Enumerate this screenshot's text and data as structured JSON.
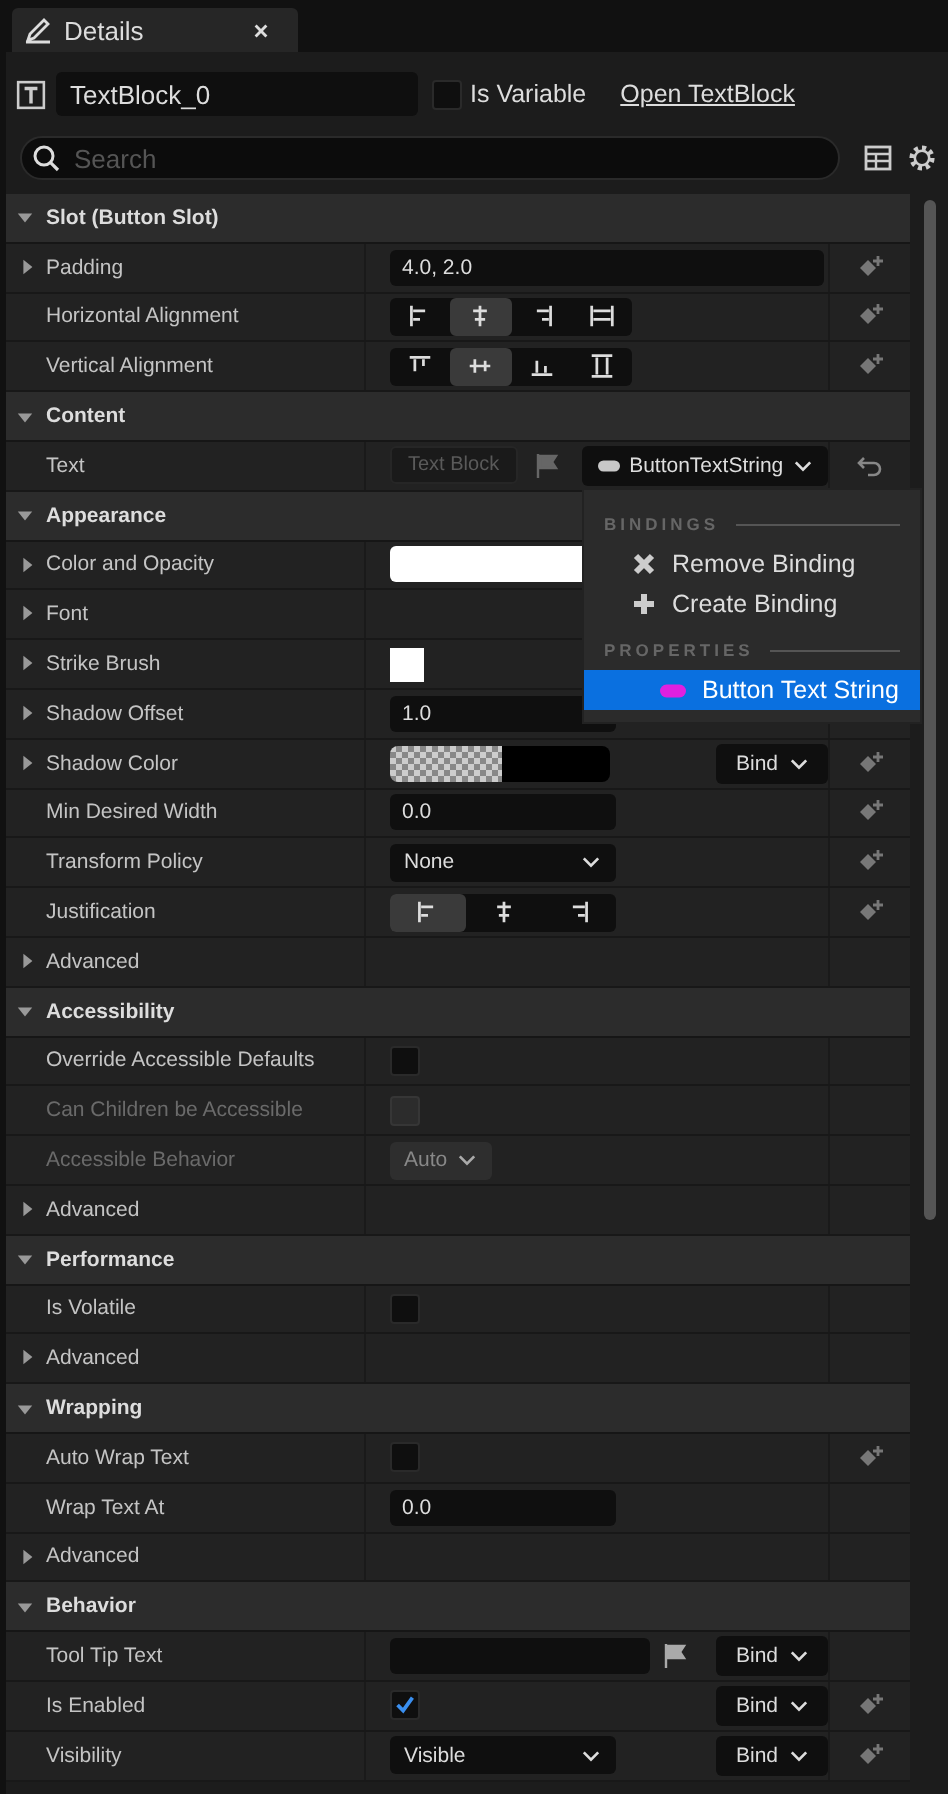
{
  "tab": {
    "title": "Details"
  },
  "header": {
    "name": "TextBlock_0",
    "is_variable": {
      "label": "Is Variable",
      "checked": false
    },
    "link": "Open TextBlock"
  },
  "search": {
    "placeholder": "Search"
  },
  "sections": [
    {
      "title": "Slot (Button Slot)",
      "expanded": true,
      "rows": [
        {
          "label": "Padding",
          "kind": "vector",
          "expanded": false,
          "value": "4.0, 2.0",
          "keyframe": true
        },
        {
          "label": "Horizontal Alignment",
          "kind": "halign",
          "options": [
            {
              "selected": false
            },
            {
              "selected": true
            },
            {
              "selected": false
            },
            {
              "selected": false
            }
          ],
          "keyframe": true
        },
        {
          "label": "Vertical Alignment",
          "kind": "valign",
          "options": [
            {
              "selected": false
            },
            {
              "selected": true
            },
            {
              "selected": false
            },
            {
              "selected": false
            }
          ],
          "keyframe": true
        }
      ]
    },
    {
      "title": "Content",
      "expanded": true,
      "rows": [
        {
          "label": "Text",
          "kind": "binding",
          "value": "Text Block",
          "binding": "ButtonTextString"
        }
      ]
    },
    {
      "title": "Appearance",
      "expanded": true,
      "rows": [
        {
          "label": "Color and Opacity",
          "kind": "color",
          "expanded": false
        },
        {
          "label": "Font",
          "kind": "none",
          "expanded": false
        },
        {
          "label": "Strike Brush",
          "kind": "brush",
          "expanded": false
        },
        {
          "label": "Shadow Offset",
          "kind": "number",
          "expanded": false,
          "value": "1.0"
        },
        {
          "label": "Shadow Color",
          "kind": "shadow",
          "expanded": false,
          "bind": "Bind",
          "keyframe": true
        },
        {
          "label": "Min Desired Width",
          "kind": "number",
          "value": "0.0",
          "keyframe": true
        },
        {
          "label": "Transform Policy",
          "kind": "dropdown",
          "value": "None",
          "keyframe": true
        },
        {
          "label": "Justification",
          "kind": "justify",
          "options": [
            {
              "selected": true
            },
            {
              "selected": false
            },
            {
              "selected": false
            }
          ],
          "keyframe": true
        },
        {
          "label": "Advanced",
          "kind": "none",
          "expanded": false
        }
      ]
    },
    {
      "title": "Accessibility",
      "expanded": true,
      "rows": [
        {
          "label": "Override Accessible Defaults",
          "kind": "checkbox",
          "checked": false,
          "disabled": false
        },
        {
          "label": "Can Children be Accessible",
          "kind": "checkbox",
          "checked": false,
          "disabled": true
        },
        {
          "label": "Accessible Behavior",
          "kind": "combo",
          "value": "Auto",
          "disabled": true
        },
        {
          "label": "Advanced",
          "kind": "none",
          "expanded": false
        }
      ]
    },
    {
      "title": "Performance",
      "expanded": true,
      "rows": [
        {
          "label": "Is Volatile",
          "kind": "checkbox",
          "checked": false,
          "disabled": false
        },
        {
          "label": "Advanced",
          "kind": "none",
          "expanded": false
        }
      ]
    },
    {
      "title": "Wrapping",
      "expanded": true,
      "rows": [
        {
          "label": "Auto Wrap Text",
          "kind": "checkbox",
          "checked": false,
          "disabled": false,
          "keyframe": true
        },
        {
          "label": "Wrap Text At",
          "kind": "number",
          "value": "0.0"
        },
        {
          "label": "Advanced",
          "kind": "none",
          "expanded": false
        }
      ]
    },
    {
      "title": "Behavior",
      "expanded": true,
      "rows": [
        {
          "label": "Tool Tip Text",
          "kind": "localized",
          "bind": "Bind"
        },
        {
          "label": "Is Enabled",
          "kind": "checkbox",
          "checked": true,
          "disabled": false,
          "bind": "Bind",
          "keyframe": true
        },
        {
          "label": "Visibility",
          "kind": "dropdown",
          "value": "Visible",
          "bind": "Bind",
          "keyframe": true
        }
      ]
    }
  ],
  "menu": {
    "groups": [
      {
        "title": "BINDINGS",
        "items": [
          {
            "label": "Remove Binding",
            "kind": "remove",
            "selected": false
          },
          {
            "label": "Create Binding",
            "kind": "create",
            "selected": false
          }
        ]
      },
      {
        "title": "PROPERTIES",
        "items": [
          {
            "label": "Button Text String",
            "kind": "property",
            "selected": true
          }
        ]
      }
    ]
  }
}
